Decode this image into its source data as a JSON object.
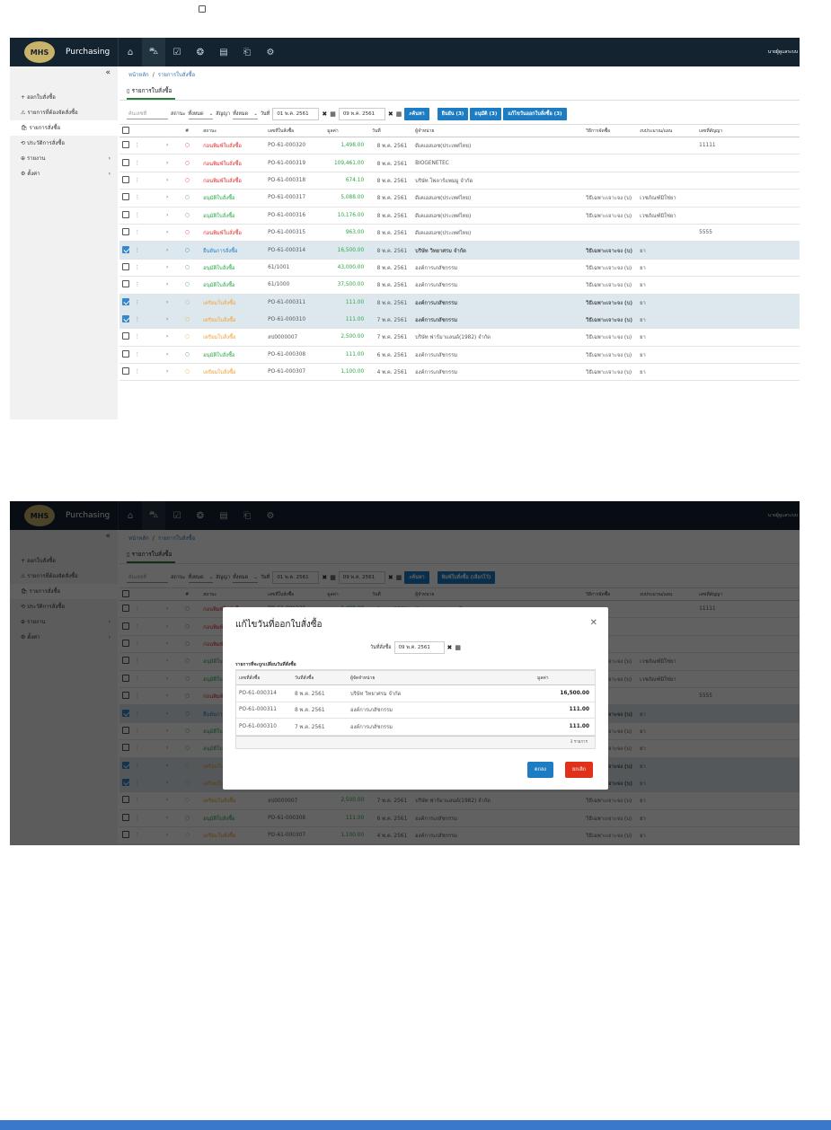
{
  "app": {
    "name": "Purchasing",
    "logo_text": "MHS",
    "user": "นายผู้ดูแลระบบ"
  },
  "sidebar": {
    "collapse": "«",
    "items": [
      {
        "icon": "+",
        "label": "ออกใบสั่งซื้อ"
      },
      {
        "icon": "⚠",
        "label": "รายการที่ต้องจัดสั่งซื้อ"
      },
      {
        "icon": "🛍",
        "label": "รายการสั่งซื้อ"
      },
      {
        "icon": "⟲",
        "label": "ประวัติการสั่งซื้อ"
      },
      {
        "icon": "⊕",
        "label": "รายงาน",
        "chevron": "›"
      },
      {
        "icon": "⚙",
        "label": "ตั้งค่า",
        "chevron": "›"
      }
    ]
  },
  "breadcrumb": {
    "home": "หน้าหลัก",
    "sep": "/",
    "current": "รายการใบสั่งซื้อ"
  },
  "tab": {
    "label": "รายการใบสั่งซื้อ"
  },
  "filter": {
    "search_placeholder": "ค้นเลขที่",
    "status_label": "สถานะ",
    "status_value": "ทั้งหมด",
    "contract_label": "สัญญา",
    "contract_value": "ทั้งหมด",
    "date_label": "วันที่",
    "date_from": "01 พ.ค. 2561",
    "date_to": "09 พ.ค. 2561",
    "search_btn": "ค้นหา",
    "btn_confirm": "ยืนยัน (3)",
    "btn_approve": "อนุมัติ (3)",
    "btn_edit_date": "แก้ไขวันออกใบสั่งซื้อ (3)",
    "btn_print": "พิมพ์ใบสั่งซื้อ (เลือกไว้)"
  },
  "table": {
    "headers": [
      "#",
      "สถานะ",
      "เลขที่ใบสั่งซื้อ",
      "มูลค่า",
      "วันที่",
      "ผู้จำหน่าย",
      "วิธีการจัดซื้อ",
      "งบประมาณ/แผน",
      "เลขที่สัญญา"
    ],
    "rows": [
      {
        "status": "ก่อนพิมพ์ใบสั่งซื้อ",
        "sc": "red",
        "po": "PO-61-000320",
        "amt": "1,498.00",
        "date": "8 พ.ค. 2561",
        "vendor": "ดีเคเอสเอช(ประเทศไทย)",
        "method": "",
        "budget": "",
        "contract": "11111",
        "sel": false
      },
      {
        "status": "ก่อนพิมพ์ใบสั่งซื้อ",
        "sc": "red",
        "po": "PO-61-000319",
        "amt": "109,461.00",
        "date": "8 พ.ค. 2561",
        "vendor": "BIOGENETEC",
        "method": "",
        "budget": "",
        "contract": "",
        "sel": false
      },
      {
        "status": "ก่อนพิมพ์ใบสั่งซื้อ",
        "sc": "red",
        "po": "PO-61-000318",
        "amt": "674.10",
        "date": "8 พ.ค. 2561",
        "vendor": "บริษัท โพลาร์แพมมู จำกัด",
        "method": "",
        "budget": "",
        "contract": "",
        "sel": false
      },
      {
        "status": "อนุมัติใบสั่งซื้อ",
        "sc": "green",
        "po": "PO-61-000317",
        "amt": "5,088.00",
        "date": "8 พ.ค. 2561",
        "vendor": "ดีเคเอสเอช(ประเทศไทย)",
        "method": "วิธีเฉพาะเจาะจง (บ)",
        "budget": "เวชภัณฑ์มิใช่ยา",
        "contract": "",
        "sel": false
      },
      {
        "status": "อนุมัติใบสั่งซื้อ",
        "sc": "green",
        "po": "PO-61-000316",
        "amt": "10,176.00",
        "date": "8 พ.ค. 2561",
        "vendor": "ดีเคเอสเอช(ประเทศไทย)",
        "method": "วิธีเฉพาะเจาะจง (บ)",
        "budget": "เวชภัณฑ์มิใช่ยา",
        "contract": "",
        "sel": false
      },
      {
        "status": "ก่อนพิมพ์ใบสั่งซื้อ",
        "sc": "red",
        "po": "PO-61-000315",
        "amt": "963.00",
        "date": "8 พ.ค. 2561",
        "vendor": "ดีเคเอสเอช(ประเทศไทย)",
        "method": "",
        "budget": "",
        "contract": "5555",
        "sel": false
      },
      {
        "status": "ยืนยันการสั่งซื้อ",
        "sc": "blue",
        "po": "PO-61-000314",
        "amt": "16,500.00",
        "date": "8 พ.ค. 2561",
        "vendor": "บริษัท วิทยาศรม จำกัด",
        "method": "วิธีเฉพาะเจาะจง (บ)",
        "budget": "ยา",
        "contract": "",
        "sel": true
      },
      {
        "status": "อนุมัติใบสั่งซื้อ",
        "sc": "green",
        "po": "61/1001",
        "amt": "43,000.00",
        "date": "8 พ.ค. 2561",
        "vendor": "องค์การเภสัชกรรม",
        "method": "วิธีเฉพาะเจาะจง (บ)",
        "budget": "ยา",
        "contract": "",
        "sel": false
      },
      {
        "status": "อนุมัติใบสั่งซื้อ",
        "sc": "green",
        "po": "61/1000",
        "amt": "37,500.00",
        "date": "8 พ.ค. 2561",
        "vendor": "องค์การเภสัชกรรม",
        "method": "วิธีเฉพาะเจาะจง (บ)",
        "budget": "ยา",
        "contract": "",
        "sel": false
      },
      {
        "status": "เตรียมใบสั่งซื้อ",
        "sc": "orange",
        "po": "PO-61-000311",
        "amt": "111.00",
        "date": "8 พ.ค. 2561",
        "vendor": "องค์การเภสัชกรรม",
        "method": "วิธีเฉพาะเจาะจง (บ)",
        "budget": "ยา",
        "contract": "",
        "sel": true
      },
      {
        "status": "เตรียมใบสั่งซื้อ",
        "sc": "orange",
        "po": "PO-61-000310",
        "amt": "111.00",
        "date": "7 พ.ค. 2561",
        "vendor": "องค์การเภสัชกรรม",
        "method": "วิธีเฉพาะเจาะจง (บ)",
        "budget": "ยา",
        "contract": "",
        "sel": true
      },
      {
        "status": "เตรียมใบสั่งซื้อ",
        "sc": "orange",
        "po": "สป0000007",
        "amt": "2,500.00",
        "date": "7 พ.ค. 2561",
        "vendor": "บริษัท ฟาร์มาแลนด์(1982) จำกัด",
        "method": "วิธีเฉพาะเจาะจง (บ)",
        "budget": "ยา",
        "contract": "",
        "sel": false
      },
      {
        "status": "อนุมัติใบสั่งซื้อ",
        "sc": "green",
        "po": "PO-61-000308",
        "amt": "111.00",
        "date": "6 พ.ค. 2561",
        "vendor": "องค์การเภสัชกรรม",
        "method": "วิธีเฉพาะเจาะจง (บ)",
        "budget": "ยา",
        "contract": "",
        "sel": false
      },
      {
        "status": "เตรียมใบสั่งซื้อ",
        "sc": "orange",
        "po": "PO-61-000307",
        "amt": "1,100.00",
        "date": "4 พ.ค. 2561",
        "vendor": "องค์การเภสัชกรรม",
        "method": "วิธีเฉพาะเจาะจง (บ)",
        "budget": "ยา",
        "contract": "",
        "sel": false
      }
    ]
  },
  "modal": {
    "title": "แก้ไขวันที่ออกใบสั่งซื้อ",
    "date_label": "วันที่สั่งซื้อ",
    "date_value": "09 พ.ค. 2561",
    "subtitle": "รายการที่จะถูกเปลี่ยนวันที่สั่งซื้อ",
    "headers": [
      "เลขที่สั่งซื้อ",
      "วันที่สั่งซื้อ",
      "ผู้จัดจำหน่าย",
      "มูลค่า"
    ],
    "rows": [
      {
        "po": "PO-61-000314",
        "date": "8 พ.ค. 2561",
        "vendor": "บริษัท วิทยาศรม จำกัด",
        "amt": "16,500.00"
      },
      {
        "po": "PO-61-000311",
        "date": "8 พ.ค. 2561",
        "vendor": "องค์การเภสัชกรรม",
        "amt": "111.00"
      },
      {
        "po": "PO-61-000310",
        "date": "7 พ.ค. 2561",
        "vendor": "องค์การเภสัชกรรม",
        "amt": "111.00"
      }
    ],
    "footer": "3 รายการ",
    "ok": "ตกลง",
    "cancel": "ยกเลิก"
  },
  "colors": {
    "topbar": "#132430",
    "primary": "#1e7cc2",
    "ok": "#1e7cc2",
    "cancel": "#e0311a",
    "selected_row": "#dde8ee"
  }
}
